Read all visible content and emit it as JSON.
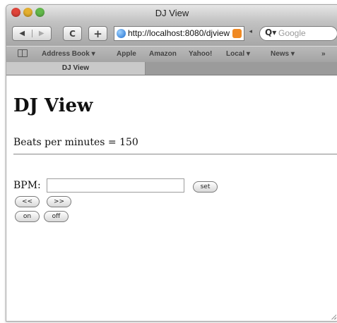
{
  "window": {
    "title": "DJ View"
  },
  "toolbar": {
    "back": "◀",
    "forward": "▶",
    "reload": "C",
    "add": "+",
    "url": "http://localhost:8080/djview",
    "search_placeholder": "Google",
    "search_icon": "Q▾"
  },
  "bookmarks": {
    "items": [
      "Address Book ▾",
      "Apple",
      "Amazon",
      "Yahoo!",
      "Local ▾",
      "News ▾",
      "»"
    ]
  },
  "tabs": [
    {
      "label": "DJ View"
    }
  ],
  "page": {
    "heading": "DJ View",
    "bpm_status": "Beats per minutes = 150",
    "bpm_label": "BPM:",
    "bpm_value": "",
    "set_label": "set",
    "decrease_label": "<<",
    "increase_label": ">>",
    "on_label": "on",
    "off_label": "off"
  },
  "colors": {
    "close": "#e0443a",
    "minimize": "#e5b02e",
    "zoom": "#63b94b"
  }
}
